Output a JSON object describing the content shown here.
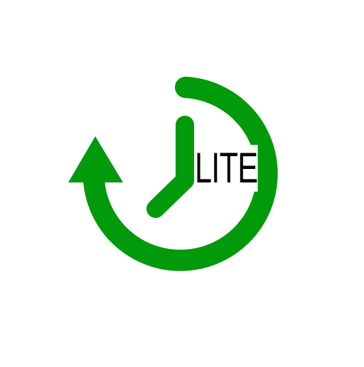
{
  "app_icon": {
    "name": "history-clock-icon",
    "badge_text": "LITE",
    "colors": {
      "accent": "#009a0a",
      "text": "#000000",
      "background": "#ffffff"
    }
  }
}
